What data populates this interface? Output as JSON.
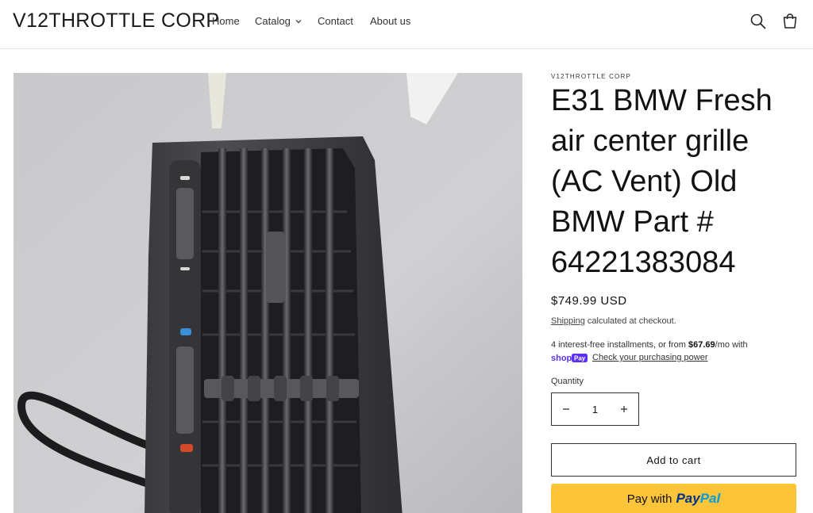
{
  "header": {
    "logo": "V12THROTTLE CORP",
    "nav": {
      "home": "Home",
      "catalog": "Catalog",
      "contact": "Contact",
      "about": "About us"
    },
    "icons": [
      "search-icon",
      "cart-icon",
      "chevron-down-icon"
    ]
  },
  "product": {
    "vendor": "V12THROTTLE CORP",
    "title": "E31 BMW Fresh air center grille (AC Vent) Old BMW Part # 64221383084",
    "price": "$749.99 USD",
    "shipping_link": "Shipping",
    "shipping_rest": " calculated at checkout.",
    "installments_pre": "4 interest-free installments, or from ",
    "installments_amount": "$67.69",
    "installments_post": "/mo with",
    "shop_pay_logo": "shop Pay",
    "check_power": "Check your purchasing power",
    "quantity_label": "Quantity",
    "quantity_value": "1",
    "add_to_cart": "Add to cart",
    "paypal_prefix": "Pay with",
    "paypal_brand_1": "Pay",
    "paypal_brand_2": "Pal"
  },
  "colors": {
    "paypal_button": "#fcc439",
    "shop_pay_purple": "#5a31f4",
    "paypal_dark_blue": "#003087",
    "paypal_light_blue": "#009cde"
  }
}
